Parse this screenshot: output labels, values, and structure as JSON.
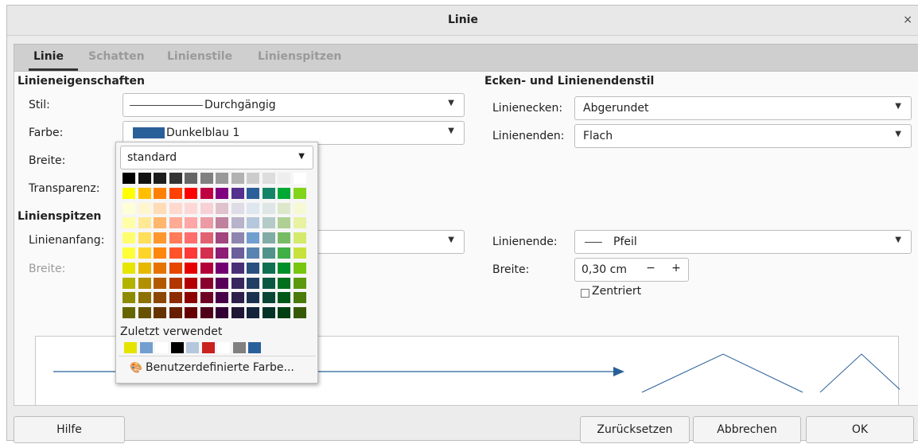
{
  "window": {
    "title": "Linie",
    "close_label": "×"
  },
  "tabs": [
    {
      "label": "Linie",
      "active": true
    },
    {
      "label": "Schatten",
      "active": false
    },
    {
      "label": "Linienstile",
      "active": false
    },
    {
      "label": "Linienspitzen",
      "active": false
    }
  ],
  "line_props": {
    "section_title": "Linieneigenschaften",
    "style_label": "Stil:",
    "style_value": "Durchgängig",
    "color_label": "Farbe:",
    "color_value": "Dunkelblau 1",
    "color_hex": "#2a6099",
    "width_label": "Breite:",
    "transparency_label": "Transparenz:"
  },
  "arrows": {
    "section_title": "Linienspitzen",
    "start_label": "Linienanfang:",
    "start_width_label": "Breite:",
    "end_label": "Linienende:",
    "end_value": "Pfeil",
    "end_width_label": "Breite:",
    "end_width_value": "0,30 cm",
    "minus": "−",
    "plus": "+",
    "centered_label": "Zentriert",
    "centered_checked": false
  },
  "corners": {
    "section_title": "Ecken- und Linienendenstil",
    "corner_label": "Linienecken:",
    "corner_value": "Abgerundet",
    "cap_label": "Linienenden:",
    "cap_value": "Flach"
  },
  "popup": {
    "palette_value": "standard",
    "recent_label": "Zuletzt verwendet",
    "custom_label": "Benutzerdefinierte Farbe...",
    "recent_colors": [
      "#e4e400",
      "#729fcf",
      "#ffffff",
      "#000000",
      "#b4c7dc",
      "#c9211e",
      "#ffffff",
      "#808080",
      "#2a6099"
    ],
    "palette": [
      [
        "#000000",
        "#111111",
        "#1c1c1c",
        "#333333",
        "#666666",
        "#808080",
        "#999999",
        "#b2b2b2",
        "#cccccc",
        "#dddddd",
        "#eeeeee",
        "#ffffff"
      ],
      [
        "#ffff00",
        "#ffbf00",
        "#ff8000",
        "#ff4000",
        "#ff0000",
        "#bf0041",
        "#800080",
        "#55308d",
        "#2a6099",
        "#158466",
        "#00a933",
        "#81d41a"
      ],
      [
        "#ffffd7",
        "#fff5ce",
        "#ffdbb6",
        "#ffd8ce",
        "#ffd7d7",
        "#f7d1d5",
        "#e0c2cd",
        "#dedce6",
        "#dee6ef",
        "#dee7e5",
        "#dde8cb",
        "#f6f9d4"
      ],
      [
        "#ffffa6",
        "#ffe994",
        "#ffb66c",
        "#ffaa95",
        "#ffa6a6",
        "#ec9ba4",
        "#bf819e",
        "#b7b3ca",
        "#b4c7dc",
        "#b3cac7",
        "#afd095",
        "#e8f2a1"
      ],
      [
        "#ffff6d",
        "#ffde59",
        "#ff972f",
        "#ff7b59",
        "#ff6d6d",
        "#e16173",
        "#a1467e",
        "#8e86ae",
        "#729fcf",
        "#81aca6",
        "#77bc65",
        "#d4ea6b"
      ],
      [
        "#ffff38",
        "#ffd428",
        "#ff860d",
        "#ff5429",
        "#ff3838",
        "#d62e4e",
        "#8d1d75",
        "#6b5e9b",
        "#5983b0",
        "#50938a",
        "#3faf46",
        "#c9e23b"
      ],
      [
        "#e6e600",
        "#e6b800",
        "#e67300",
        "#e64500",
        "#e60000",
        "#b30039",
        "#730073",
        "#483076",
        "#2a5080",
        "#0e7051",
        "#008f29",
        "#78c60f"
      ],
      [
        "#b2b200",
        "#b28f00",
        "#b25900",
        "#b23600",
        "#b20000",
        "#8a002c",
        "#590059",
        "#37275e",
        "#213f65",
        "#0b5842",
        "#00701e",
        "#5d990c"
      ],
      [
        "#8c8c00",
        "#8c7000",
        "#8c4600",
        "#8c2b00",
        "#8c0000",
        "#6e0023",
        "#470047",
        "#2c1f4b",
        "#1a3150",
        "#084534",
        "#005818",
        "#4a7a09"
      ],
      [
        "#666600",
        "#665200",
        "#663300",
        "#661f00",
        "#660000",
        "#500019",
        "#330033",
        "#201636",
        "#13243b",
        "#063326",
        "#004012",
        "#365906"
      ]
    ]
  },
  "buttons": {
    "help": "Hilfe",
    "reset": "Zurücksetzen",
    "cancel": "Abbrechen",
    "ok": "OK"
  }
}
